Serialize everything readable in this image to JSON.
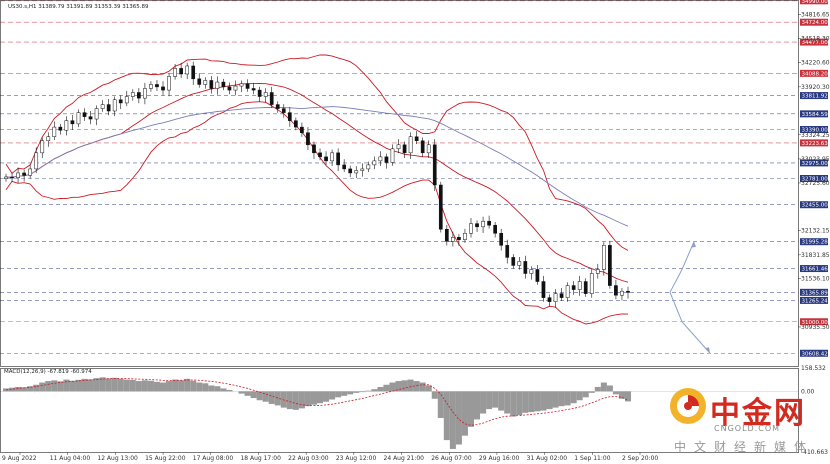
{
  "chart_data": {
    "type": "candlestick",
    "title": "US30.s,H1  31389.79 31391.89 31353.39 31365.89",
    "price_axis": {
      "ylim": [
        30450,
        35000
      ],
      "tick_labels": [
        {
          "value": 34816.65,
          "label": "34816.65"
        },
        {
          "value": 34518.3,
          "label": "34518.30"
        },
        {
          "value": 34220.6,
          "label": "34220.60"
        },
        {
          "value": 33920.3,
          "label": "33920.30"
        },
        {
          "value": 33324.25,
          "label": "33324.25"
        },
        {
          "value": 33023.95,
          "label": "33023.95"
        },
        {
          "value": 32725.6,
          "label": "32725.60"
        },
        {
          "value": 32132.15,
          "label": "32132.15"
        },
        {
          "value": 31831.85,
          "label": "31831.85"
        },
        {
          "value": 31536.1,
          "label": "31536.10"
        },
        {
          "value": 30935.5,
          "label": "30935.50"
        }
      ]
    },
    "levels": [
      {
        "value": 34990.0,
        "label": "34990.00",
        "color": "#c8323c"
      },
      {
        "value": 34724.0,
        "label": "34724.00",
        "color": "#c8323c"
      },
      {
        "value": 34477.0,
        "label": "34477.00",
        "color": "#c8323c"
      },
      {
        "value": 34088.2,
        "label": "34088.20",
        "color": "#c8323c"
      },
      {
        "value": 33811.92,
        "label": "33811.92",
        "color": "#2a3a80"
      },
      {
        "value": 33584.59,
        "label": "33584.59",
        "color": "#2a3a80"
      },
      {
        "value": 33390.0,
        "label": "33390.00",
        "color": "#2a3a80"
      },
      {
        "value": 33223.63,
        "label": "33223.63",
        "color": "#c8323c"
      },
      {
        "value": 32975.0,
        "label": "32975.00",
        "color": "#2a3a80"
      },
      {
        "value": 32781.0,
        "label": "32781.00",
        "color": "#2a3a80"
      },
      {
        "value": 32455.0,
        "label": "32455.00",
        "color": "#2a3a80"
      },
      {
        "value": 31995.28,
        "label": "31995.28",
        "color": "#2a3a80"
      },
      {
        "value": 31661.46,
        "label": "31661.46",
        "color": "#2a3a80"
      },
      {
        "value": 31365.89,
        "label": "31365.89",
        "color": "#2a3a80"
      },
      {
        "value": 31265.24,
        "label": "31265.24",
        "color": "#2a3a80"
      },
      {
        "value": 31000.0,
        "label": "31000.00",
        "color": "#c8323c"
      },
      {
        "value": 30608.42,
        "label": "30608.42",
        "color": "#2a3a80"
      }
    ],
    "series_close": [
      32800,
      32790,
      32850,
      32820,
      32900,
      33100,
      33250,
      33300,
      33420,
      33380,
      33500,
      33460,
      33600,
      33550,
      33520,
      33650,
      33700,
      33620,
      33760,
      33720,
      33800,
      33850,
      33780,
      33900,
      33950,
      33920,
      33880,
      34050,
      34150,
      34080,
      34180,
      34020,
      33950,
      34000,
      33900,
      33980,
      33920,
      33880,
      33930,
      33960,
      33900,
      33880,
      33800,
      33850,
      33700,
      33650,
      33600,
      33500,
      33420,
      33350,
      33200,
      33100,
      33050,
      33000,
      33100,
      32950,
      32900,
      32850,
      32880,
      32900,
      32950,
      33000,
      33050,
      32980,
      33150,
      33200,
      33100,
      33300,
      33250,
      33100,
      33200,
      32700,
      32150,
      32000,
      32050,
      32020,
      32100,
      32220,
      32180,
      32250,
      32200,
      32100,
      31950,
      31800,
      31700,
      31750,
      31600,
      31650,
      31500,
      31300,
      31250,
      31350,
      31300,
      31450,
      31400,
      31500,
      31350,
      31600,
      31650,
      31950,
      31450,
      31330,
      31380,
      31365
    ],
    "macd": {
      "label": "MACD(12,26,9) -67.819 -60.974",
      "tick_labels": [
        {
          "value": 158.532,
          "label": "158.532"
        },
        {
          "value": 0.0,
          "label": "0.00"
        },
        {
          "value": -410.663,
          "label": "-410.663"
        }
      ],
      "ylim": [
        -410.663,
        158.532
      ],
      "hist": [
        20,
        25,
        30,
        28,
        35,
        45,
        60,
        70,
        75,
        68,
        80,
        72,
        78,
        85,
        82,
        90,
        95,
        88,
        92,
        85,
        80,
        78,
        70,
        75,
        72,
        65,
        60,
        70,
        80,
        75,
        85,
        72,
        60,
        55,
        40,
        35,
        20,
        10,
        0,
        -15,
        -30,
        -45,
        -60,
        -70,
        -85,
        -95,
        -110,
        -120,
        -125,
        -115,
        -100,
        -90,
        -80,
        -70,
        -55,
        -40,
        -30,
        -20,
        -10,
        -5,
        5,
        15,
        30,
        45,
        60,
        70,
        75,
        80,
        70,
        60,
        40,
        -50,
        -180,
        -330,
        -390,
        -360,
        -300,
        -240,
        -190,
        -150,
        -120,
        -110,
        -130,
        -150,
        -170,
        -160,
        -145,
        -140,
        -135,
        -130,
        -120,
        -110,
        -100,
        -95,
        -80,
        -60,
        -40,
        -10,
        30,
        60,
        40,
        -20,
        -50,
        -68
      ],
      "signal": [
        10,
        15,
        20,
        24,
        28,
        33,
        40,
        48,
        55,
        60,
        65,
        68,
        71,
        74,
        77,
        80,
        84,
        86,
        88,
        88,
        87,
        85,
        83,
        82,
        80,
        78,
        75,
        74,
        75,
        75,
        77,
        77,
        75,
        72,
        68,
        62,
        56,
        48,
        40,
        30,
        20,
        8,
        -5,
        -18,
        -32,
        -45,
        -58,
        -70,
        -82,
        -90,
        -95,
        -96,
        -95,
        -92,
        -87,
        -80,
        -72,
        -64,
        -56,
        -48,
        -38,
        -28,
        -18,
        -8,
        2,
        12,
        22,
        32,
        40,
        45,
        45,
        20,
        -20,
        -80,
        -140,
        -190,
        -220,
        -230,
        -225,
        -215,
        -200,
        -185,
        -175,
        -168,
        -166,
        -164,
        -160,
        -156,
        -152,
        -148,
        -143,
        -137,
        -130,
        -123,
        -115,
        -105,
        -93,
        -78,
        -62,
        -46,
        -36,
        -35,
        -40,
        -61
      ]
    },
    "time_labels": [
      "9 Aug 2022",
      "11 Aug 04:00",
      "12 Aug 13:00",
      "15 Aug 22:00",
      "17 Aug 08:00",
      "18 Aug 17:00",
      "22 Aug 03:00",
      "23 Aug 12:00",
      "24 Aug 21:00",
      "26 Aug 07:00",
      "29 Aug 16:00",
      "31 Aug 02:00",
      "1 Sep 11:00",
      "2 Sep 20:00"
    ],
    "colors": {
      "bollinger": "#cc1b24",
      "ma": "#7a7fb8",
      "candle": "#111111",
      "macd_hist": "#999999",
      "macd_signal": "#cc1b24",
      "arrows": "#8aa0c8"
    }
  },
  "watermark": {
    "name": "中金网",
    "url": "CNGOLD.COM",
    "subtitle": "中文财经新媒体"
  }
}
